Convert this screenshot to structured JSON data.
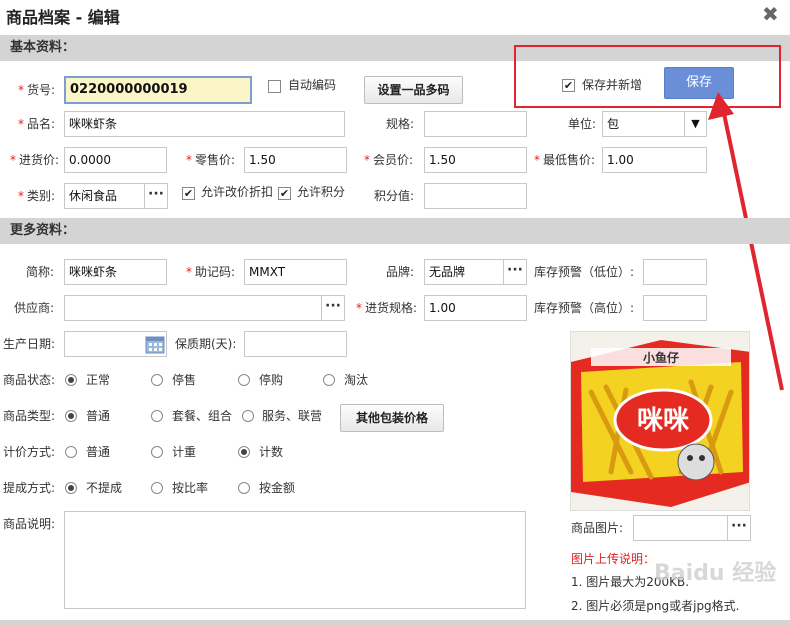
{
  "dialog": {
    "title": "商品档案 - 编辑"
  },
  "basic": {
    "section": "基本资料：",
    "code_label": "货号:",
    "code_value": "0220000000019",
    "auto_code_label": "自动编码",
    "multi_code_button": "设置一品多码",
    "save_new_label": "保存并新增",
    "save_button": "保存",
    "name_label": "品名:",
    "name_value": "咪咪虾条",
    "spec_label": "规格:",
    "spec_value": "",
    "unit_label": "单位:",
    "unit_value": "包",
    "purchase_label": "进货价:",
    "purchase_value": "0.0000",
    "retail_label": "零售价:",
    "retail_value": "1.50",
    "member_label": "会员价:",
    "member_value": "1.50",
    "min_label": "最低售价:",
    "min_value": "1.00",
    "category_label": "类别:",
    "category_value": "休闲食品",
    "allow_discount_label": "允许改价折扣",
    "allow_points_label": "允许积分",
    "points_label": "积分值:",
    "points_value": ""
  },
  "more": {
    "section": "更多资料：",
    "short_label": "简称:",
    "short_value": "咪咪虾条",
    "mnemonic_label": "助记码:",
    "mnemonic_value": "MMXT",
    "brand_label": "品牌:",
    "brand_value": "无品牌",
    "stock_low_label": "库存预警（低位）:",
    "stock_low_value": "",
    "supplier_label": "供应商:",
    "supplier_value": "",
    "pack_spec_label": "进货规格:",
    "pack_spec_value": "1.00",
    "stock_high_label": "库存预警（高位）:",
    "stock_high_value": "",
    "prod_date_label": "生产日期:",
    "prod_date_value": "",
    "shelf_label": "保质期(天):",
    "shelf_value": "",
    "status_label": "商品状态:",
    "status_options": [
      "正常",
      "停售",
      "停购",
      "淘汰"
    ],
    "type_label": "商品类型:",
    "type_options": [
      "普通",
      "套餐、组合",
      "服务、联营"
    ],
    "pack_price_button": "其他包装价格",
    "pricing_label": "计价方式:",
    "pricing_options": [
      "普通",
      "计重",
      "计数"
    ],
    "commission_label": "提成方式:",
    "commission_options": [
      "不提成",
      "按比率",
      "按金额"
    ],
    "desc_label": "商品说明:",
    "desc_value": "",
    "image_label": "商品图片:",
    "image_value": "",
    "upload_title": "图片上传说明：",
    "upload_note1": "1. 图片最大为200KB.",
    "upload_note2": "2. 图片必须是png或者jpg格式.",
    "product_brand_text": "咪咪",
    "product_top_text": "小鱼仔"
  },
  "watermark": "Baidu 经验",
  "colors": {
    "accent": "#6a8fd8",
    "highlight": "#e0252e",
    "bar": "#d4d4d4"
  }
}
